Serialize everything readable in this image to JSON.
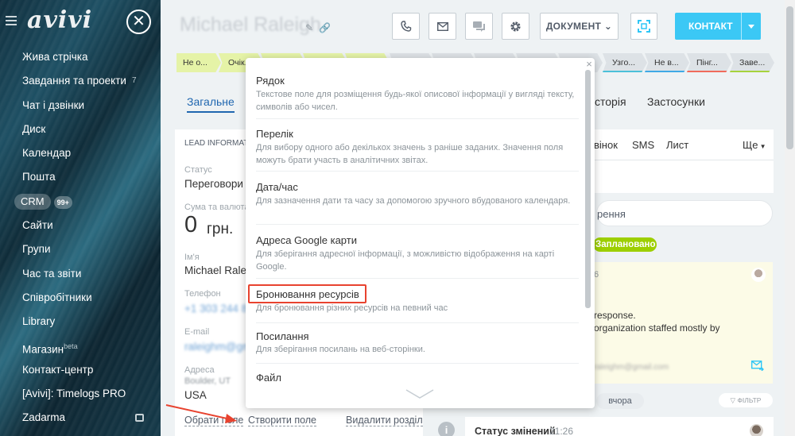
{
  "sidebar": {
    "logo": "avivi",
    "items": [
      {
        "label": "Жива стрічка"
      },
      {
        "label": "Завдання та проекти",
        "count": "7"
      },
      {
        "label": "Чат і дзвінки"
      },
      {
        "label": "Диск"
      },
      {
        "label": "Календар"
      },
      {
        "label": "Пошта"
      },
      {
        "label": "CRM",
        "badge": "99+"
      },
      {
        "label": "Сайти"
      },
      {
        "label": "Групи"
      },
      {
        "label": "Час та звіти"
      },
      {
        "label": "Співробітники"
      },
      {
        "label": "Library"
      },
      {
        "label": "Магазин",
        "sup": "beta"
      },
      {
        "label": "Контакт-центр"
      },
      {
        "label": "[Avivi]: Timelogs PRO"
      },
      {
        "label": "Zadarma"
      }
    ]
  },
  "header": {
    "title": "Michael Raleigh",
    "document_label": "ДОКУМЕНТ",
    "contact_label": "КОНТАКТ"
  },
  "stages": [
    {
      "label": "Не о...",
      "color": "#e5f3a7"
    },
    {
      "label": "Очік...",
      "color": "#e5f3a7"
    },
    {
      "label": "",
      "color": "#e5f3a7"
    },
    {
      "label": "",
      "color": "#e5f3a7"
    },
    {
      "label": "",
      "color": "#e5f3a7"
    },
    {
      "label": "",
      "color": "#dde2e6"
    },
    {
      "label": "",
      "color": "#dde2e6"
    },
    {
      "label": "",
      "color": "#dde2e6"
    },
    {
      "label": "",
      "color": "#dde2e6"
    },
    {
      "label": "",
      "color": "#dde2e6"
    },
    {
      "label": "Узго...",
      "color": "#dde2e6",
      "line": "#4bc0d9"
    },
    {
      "label": "Не в...",
      "color": "#dde2e6",
      "line": "#3fa9e6"
    },
    {
      "label": "Пінг...",
      "color": "#dde2e6",
      "line": "#f06b5c"
    },
    {
      "label": "Заве...",
      "color": "#dde2e6",
      "line": "#a6d33c"
    }
  ],
  "tabs": {
    "general": "Загальне",
    "history": "сторія",
    "apps": "Застосунки"
  },
  "lead": {
    "heading": "LEAD INFORMATI",
    "status_label": "Статус",
    "status_value": "Переговори",
    "sum_label": "Сума та валюта",
    "sum_value": "0",
    "sum_currency": "грн.",
    "name_label": "Ім'я",
    "name_value": "Michael Raleig",
    "phone_label": "Телефон",
    "phone_value": "+1 303 244 8",
    "email_label": "E-mail",
    "email_value": "raleighm@gm",
    "address_label": "Адреса",
    "address_value": "Boulder, UT",
    "address_country": "USA",
    "link_choose": "Обрати поле",
    "link_create": "Створити поле",
    "link_delete": "Видалити розділ"
  },
  "activity": {
    "tab_call": "вінок",
    "tab_sms": "SMS",
    "tab_letter": "Лист",
    "tab_more": "Ще",
    "input_text": "рення",
    "planned": "Заплановано",
    "day_fragment": "6",
    "text1": "response.",
    "text2": "organization staffed mostly by",
    "email_blur": "raleighm@gmail.com",
    "yesterday": "вчора",
    "filter": "ФІЛЬТР",
    "status_changed": "Статус змінений",
    "status_time": "21:26"
  },
  "dropdown": {
    "items": [
      {
        "title": "Рядок",
        "desc": "Текстове поле для розміщення будь-якої описової інформації у вигляді тексту, символів або чисел."
      },
      {
        "title": "Перелік",
        "desc": "Для вибору одного або декількох значень з раніше заданих. Значення поля можуть брати участь в аналітичних звітах."
      },
      {
        "title": "Дата/час",
        "desc": "Для зазначення дати та часу за допомогою зручного вбудованого календаря."
      },
      {
        "title": "Адреса Google карти",
        "desc": "Для зберігання адресної інформації, з можливістю відображення на карті Google."
      },
      {
        "title": "Бронювання ресурсів",
        "desc": "Для бронювання різних ресурсів на певний час"
      },
      {
        "title": "Посилання",
        "desc": "Для зберігання посилань на веб-сторінки."
      },
      {
        "title": "Файл",
        "desc": ""
      }
    ]
  },
  "colors": {
    "accent": "#3bc8f5",
    "highlight": "#e8432f",
    "planned_badge": "#9dcf00",
    "arrow": "#e8432f"
  }
}
